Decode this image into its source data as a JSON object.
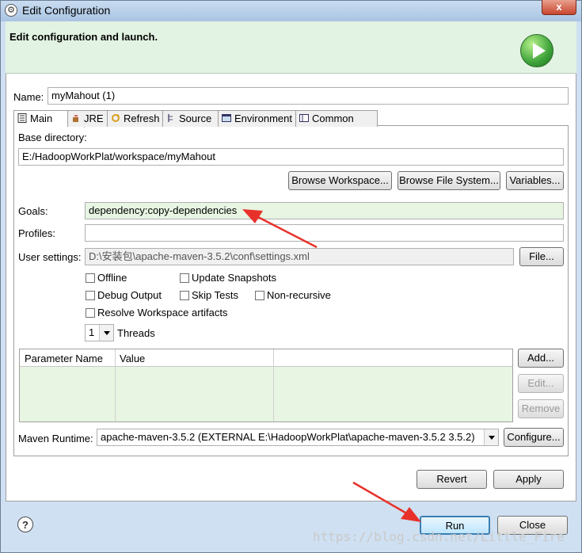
{
  "window": {
    "title": "Edit Configuration",
    "close_glyph": "x",
    "app_icon": "configuration-icon",
    "banner_text": "Edit configuration and launch."
  },
  "name": {
    "label": "Name:",
    "value": "myMahout (1)"
  },
  "tabs": [
    {
      "label": "Main",
      "icon": "main-tab-icon"
    },
    {
      "label": "JRE",
      "icon": "jre-icon"
    },
    {
      "label": "Refresh",
      "icon": "refresh-icon"
    },
    {
      "label": "Source",
      "icon": "source-icon"
    },
    {
      "label": "Environment",
      "icon": "environment-icon"
    },
    {
      "label": "Common",
      "icon": "common-icon"
    }
  ],
  "base_directory": {
    "label": "Base directory:",
    "value": "E:/HadoopWorkPlat/workspace/myMahout",
    "buttons": [
      "Browse Workspace...",
      "Browse File System...",
      "Variables..."
    ]
  },
  "goals": {
    "label": "Goals:",
    "value": "dependency:copy-dependencies"
  },
  "profiles": {
    "label": "Profiles:",
    "value": ""
  },
  "user_settings": {
    "label": "User settings:",
    "value": "D:\\安装包\\apache-maven-3.5.2\\conf\\settings.xml",
    "button": "File..."
  },
  "checkboxes": {
    "offline": "Offline",
    "update_snapshots": "Update Snapshots",
    "debug_output": "Debug Output",
    "skip_tests": "Skip Tests",
    "non_recursive": "Non-recursive",
    "resolve_workspace": "Resolve Workspace artifacts"
  },
  "threads": {
    "value": "1",
    "label": "Threads"
  },
  "params_table": {
    "columns": [
      "Parameter Name",
      "Value"
    ],
    "buttons": [
      "Add...",
      "Edit...",
      "Remove"
    ]
  },
  "maven_runtime": {
    "label": "Maven Runtime:",
    "value": "apache-maven-3.5.2 (EXTERNAL E:\\HadoopWorkPlat\\apache-maven-3.5.2 3.5.2)",
    "button": "Configure..."
  },
  "actions": {
    "revert": "Revert",
    "apply": "Apply",
    "run": "Run",
    "close": "Close"
  },
  "watermark": "https://blog.csdn.net/Little_Fire",
  "colors": {
    "annotation_arrow": "#e8312a",
    "banner_bg": "#e3f3e3",
    "goals_bg": "#e7f5e2"
  }
}
